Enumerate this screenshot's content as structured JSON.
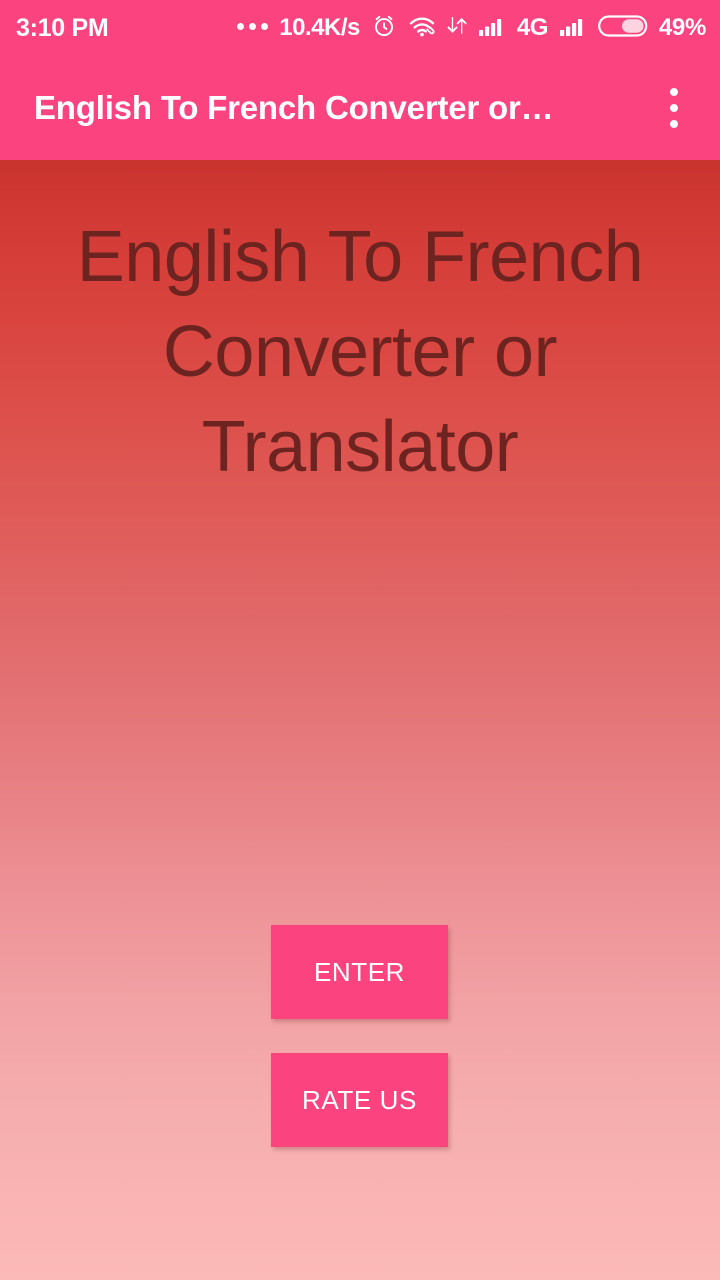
{
  "status_bar": {
    "time": "3:10 PM",
    "more_icon": "more-dots-icon",
    "network_speed": "10.4K/s",
    "alarm_icon": "alarm-clock-icon",
    "wifi_icon": "wifi-icon",
    "data_transfer_icon": "data-transfer-arrows-icon",
    "signal_icon_1": "signal-bars-icon",
    "network_type": "4G",
    "signal_icon_2": "signal-bars-icon",
    "battery_icon": "battery-icon",
    "battery_percent": "49%",
    "background_color": "#fb4380"
  },
  "app_bar": {
    "title": "English To French Converter or…",
    "overflow_icon": "overflow-menu-icon",
    "background_color": "#fb4380",
    "title_color": "#ffffff"
  },
  "main": {
    "headline": "English To French Converter or Translator",
    "headline_color": "#6d2420",
    "gradient_top": "#c9332e",
    "gradient_bottom": "#fbb9b8",
    "buttons": [
      {
        "label": "ENTER",
        "name": "enter-button",
        "color": "#fb4380"
      },
      {
        "label": "RATE US",
        "name": "rate-us-button",
        "color": "#fb4380"
      }
    ]
  }
}
